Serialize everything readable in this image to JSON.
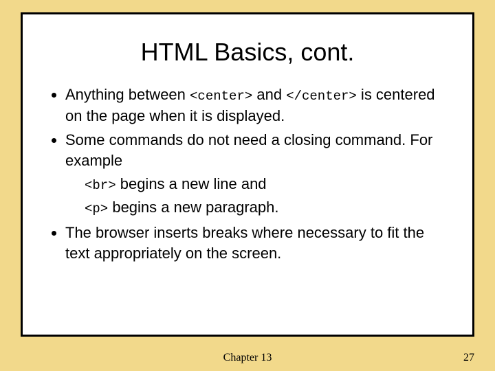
{
  "title": "HTML Basics, cont.",
  "bullets": {
    "b1_pre": "Anything between ",
    "b1_code1": "<center>",
    "b1_mid": " and ",
    "b1_code2": "</center>",
    "b1_post": " is centered on the page when it is displayed.",
    "b2": "Some commands do not need a closing command.  For example",
    "b2s1_code": "<br>",
    "b2s1_text": " begins a new line and",
    "b2s2_code": "<p>",
    "b2s2_text": " begins a new paragraph.",
    "b3": "The browser inserts breaks where necessary to fit the text appropriately on the screen."
  },
  "footer": {
    "chapter": "Chapter 13",
    "page": "27"
  }
}
